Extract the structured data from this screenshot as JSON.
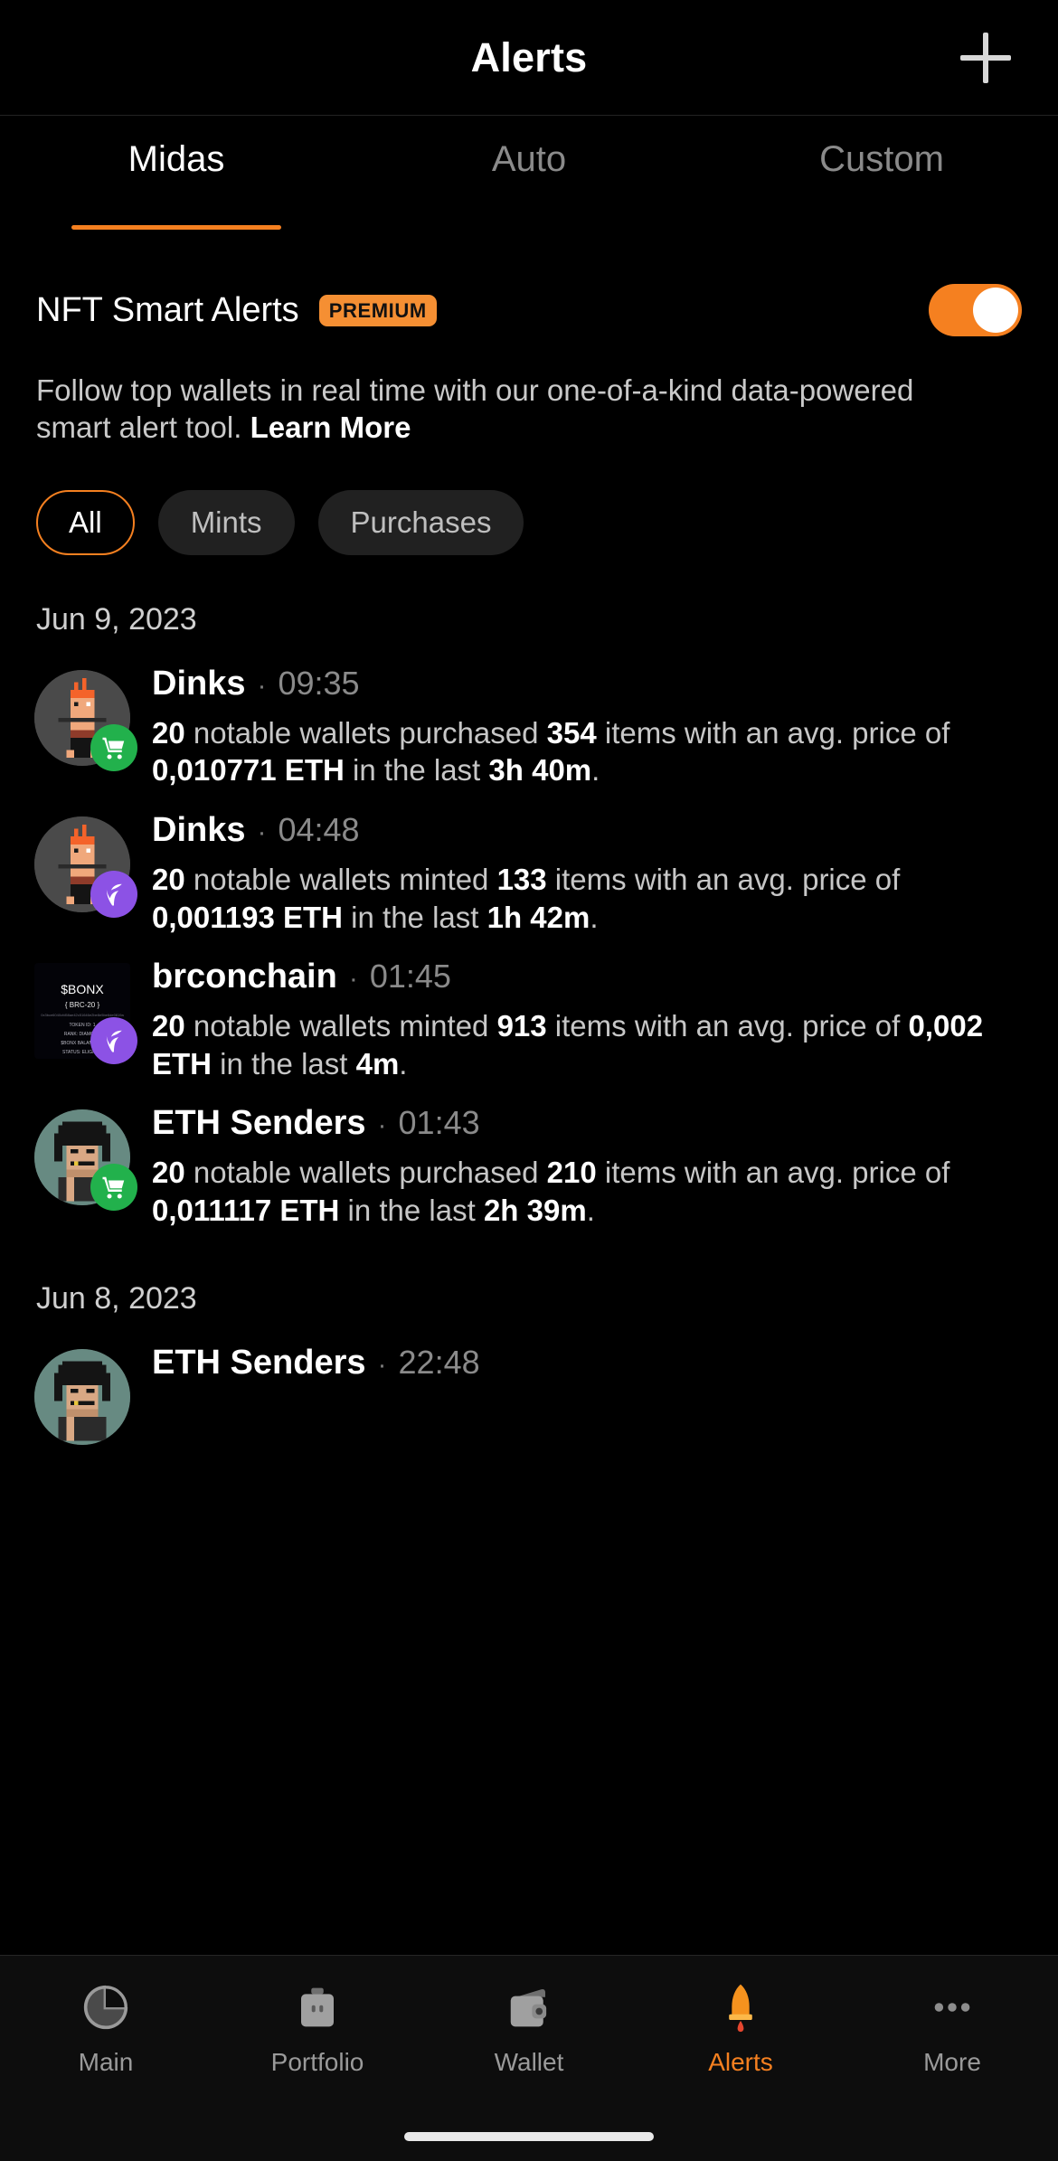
{
  "header": {
    "title": "Alerts",
    "add_icon": "plus-icon"
  },
  "tabs": [
    {
      "label": "Midas",
      "active": true
    },
    {
      "label": "Auto",
      "active": false
    },
    {
      "label": "Custom",
      "active": false
    }
  ],
  "smart_alerts": {
    "title": "NFT Smart Alerts",
    "badge": "PREMIUM",
    "toggle_on": true,
    "description": "Follow top wallets in real time with our one-of-a-kind data-powered smart alert tool. ",
    "learn_more": "Learn More"
  },
  "filters": [
    {
      "label": "All",
      "selected": true
    },
    {
      "label": "Mints",
      "selected": false
    },
    {
      "label": "Purchases",
      "selected": false
    }
  ],
  "groups": [
    {
      "date": "Jun 9, 2023",
      "alerts": [
        {
          "name": "Dinks",
          "separator": "·",
          "time": "09:35",
          "type": "purchase",
          "avatar": "dinks-avatar",
          "text_parts": [
            {
              "t": "20",
              "b": true
            },
            {
              "t": " notable wallets purchased ",
              "b": false
            },
            {
              "t": "354",
              "b": true
            },
            {
              "t": " items with an avg. price of ",
              "b": false
            },
            {
              "t": "0,010771 ETH",
              "b": true
            },
            {
              "t": " in the last ",
              "b": false
            },
            {
              "t": "3h 40m",
              "b": true
            },
            {
              "t": ".",
              "b": false
            }
          ]
        },
        {
          "name": "Dinks",
          "separator": "·",
          "time": "04:48",
          "type": "mint",
          "avatar": "dinks-avatar",
          "text_parts": [
            {
              "t": "20",
              "b": true
            },
            {
              "t": " notable wallets minted ",
              "b": false
            },
            {
              "t": "133",
              "b": true
            },
            {
              "t": " items with an avg. price of ",
              "b": false
            },
            {
              "t": "0,001193 ETH",
              "b": true
            },
            {
              "t": " in the last ",
              "b": false
            },
            {
              "t": "1h 42m",
              "b": true
            },
            {
              "t": ".",
              "b": false
            }
          ]
        },
        {
          "name": "brconchain",
          "separator": "·",
          "time": "01:45",
          "type": "mint",
          "avatar": "bonx-avatar",
          "avatar_text": {
            "ticker": "$BONX",
            "standard": "{ BRC-20 }"
          },
          "text_parts": [
            {
              "t": "20",
              "b": true
            },
            {
              "t": " notable wallets minted ",
              "b": false
            },
            {
              "t": "913",
              "b": true
            },
            {
              "t": " items with an avg. price of ",
              "b": false
            },
            {
              "t": "0,002 ETH",
              "b": true
            },
            {
              "t": " in the last ",
              "b": false
            },
            {
              "t": "4m",
              "b": true
            },
            {
              "t": ".",
              "b": false
            }
          ]
        },
        {
          "name": "ETH Senders",
          "separator": "·",
          "time": "01:43",
          "type": "purchase",
          "avatar": "punk-avatar",
          "text_parts": [
            {
              "t": "20",
              "b": true
            },
            {
              "t": " notable wallets purchased ",
              "b": false
            },
            {
              "t": "210",
              "b": true
            },
            {
              "t": " items with an avg. price of ",
              "b": false
            },
            {
              "t": "0,011117 ETH",
              "b": true
            },
            {
              "t": " in the last ",
              "b": false
            },
            {
              "t": "2h 39m",
              "b": true
            },
            {
              "t": ".",
              "b": false
            }
          ]
        }
      ]
    },
    {
      "date": "Jun 8, 2023",
      "alerts": [
        {
          "name": "ETH Senders",
          "separator": "·",
          "time": "22:48",
          "type": "purchase",
          "avatar": "punk-avatar",
          "text_parts": []
        }
      ]
    }
  ],
  "bottom_nav": [
    {
      "label": "Main",
      "icon": "pie-chart-icon",
      "active": false
    },
    {
      "label": "Portfolio",
      "icon": "briefcase-icon",
      "active": false
    },
    {
      "label": "Wallet",
      "icon": "wallet-icon",
      "active": false
    },
    {
      "label": "Alerts",
      "icon": "rocket-icon",
      "active": true
    },
    {
      "label": "More",
      "icon": "ellipsis-icon",
      "active": false
    }
  ],
  "colors": {
    "accent": "#f58020",
    "purchase_badge": "#22b14c",
    "mint_badge": "#8c52e5",
    "background": "#000000"
  }
}
